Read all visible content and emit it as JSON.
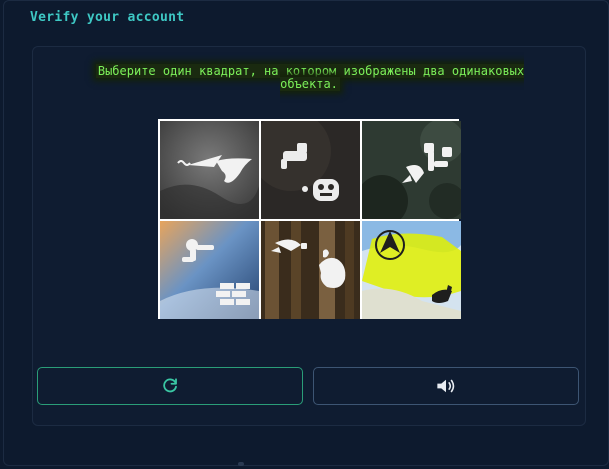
{
  "header": {
    "title": "Verify your account"
  },
  "captcha": {
    "instruction": "Выберите один квадрат, на котором изображены два одинаковых объекта.",
    "tiles": [
      {
        "id": 1,
        "objects": [
          "paper-plane",
          "bird"
        ]
      },
      {
        "id": 2,
        "objects": [
          "faucet",
          "robot"
        ]
      },
      {
        "id": 3,
        "objects": [
          "rocket",
          "robot-arm"
        ]
      },
      {
        "id": 4,
        "objects": [
          "robot-arm",
          "bricks"
        ]
      },
      {
        "id": 5,
        "objects": [
          "rocket",
          "squirrel"
        ]
      },
      {
        "id": 6,
        "objects": [
          "navigation-arrow",
          "musical-note"
        ]
      }
    ]
  },
  "buttons": {
    "refresh_icon": "refresh-icon",
    "audio_icon": "speaker-icon"
  },
  "colors": {
    "background": "#0d1a2e",
    "title": "#3ec8c4",
    "instruction": "#7cf05a",
    "refresh_border": "#2a9d78",
    "audio_border": "#3d5573"
  }
}
